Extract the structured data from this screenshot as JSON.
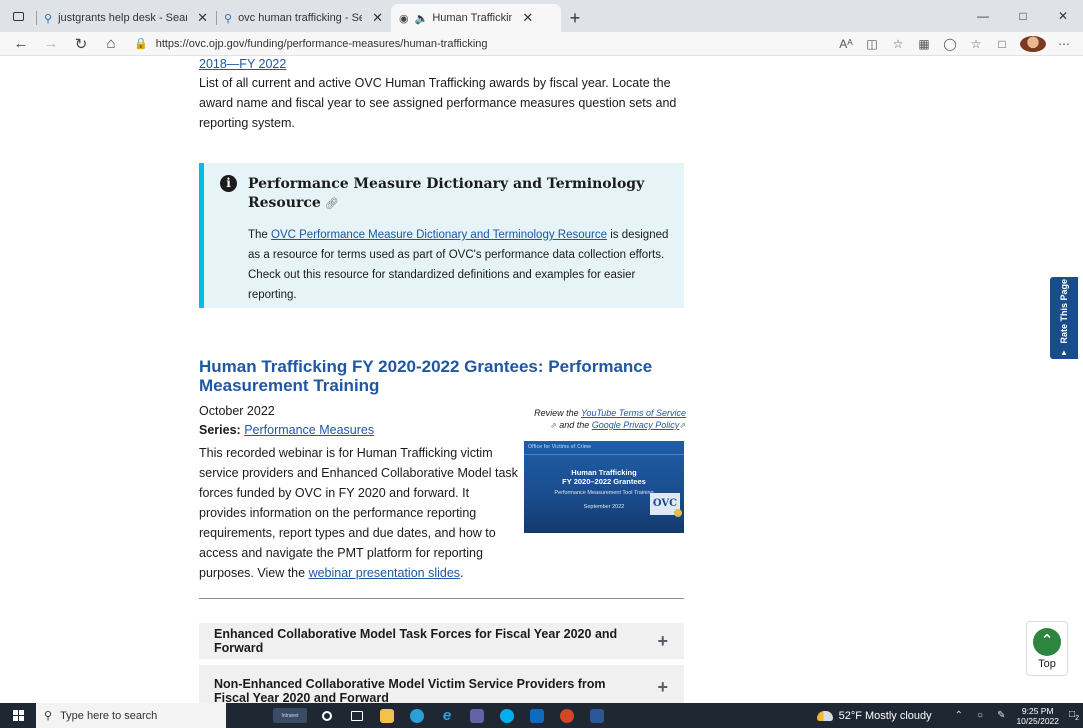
{
  "browser": {
    "tabs": [
      {
        "label": "justgrants help desk - Search",
        "icon": "search-icon"
      },
      {
        "label": "ovc human trafficking - Search",
        "icon": "search-icon"
      },
      {
        "label": "Human Trafficking Grantee",
        "icon": "speaker-icon",
        "active": true
      }
    ],
    "new_tab_glyph": "+",
    "url": "https://ovc.ojp.gov/funding/performance-measures/human-trafficking",
    "reader_glyph": "Aᴬ"
  },
  "page": {
    "top_link": "2018—FY 2022",
    "top_desc": "List of all current and active OVC Human Trafficking awards by fiscal year. Locate the award name and fiscal year to see assigned performance measures question sets and reporting system.",
    "info_box": {
      "title": "Performance Measure Dictionary and Terminology Resource",
      "body_prefix": "The ",
      "body_link": "OVC Performance Measure Dictionary and Terminology Resource",
      "body_suffix": " is designed as a resource for terms used as part of OVC's performance data collection efforts. Check out this resource for standardized definitions and examples for easier reporting."
    },
    "section": {
      "heading": "Human Trafficking FY 2020-2022 Grantees: Performance Measurement Training",
      "date": "October 2022",
      "series_label": "Series:",
      "series_link": "Performance Measures",
      "body_prefix": "This recorded webinar is for Human Trafficking victim service providers and Enhanced Collaborative Model task forces funded by OVC in FY 2020 and forward. It provides information on the performance reporting requirements, report types and due dates, and how to access and navigate the PMT platform for reporting purposes. View the ",
      "body_link": "webinar presentation slides",
      "body_suffix": ".",
      "note_prefix": "Review the ",
      "note_link1": "YouTube Terms of Service",
      "note_mid": " and the ",
      "note_link2": "Google Privacy Policy",
      "thumbnail": {
        "header": "Office for Victims of Crime",
        "line1": "Human Trafficking",
        "line2": "FY 2020–2022 Grantees",
        "line3": "Performance Measurement Tool Training",
        "line4": "September 2022",
        "logo": "OVC"
      }
    },
    "accordions": [
      {
        "label": "Enhanced Collaborative Model Task Forces for Fiscal Year 2020 and Forward"
      },
      {
        "label": "Non-Enhanced Collaborative Model Victim Service Providers from Fiscal Year 2020 and Forward"
      }
    ],
    "rate_this_page": "Rate This Page",
    "top_button": "Top"
  },
  "taskbar": {
    "search_placeholder": "Type here to search",
    "intranet_label": "Intranet",
    "weather": "52°F  Mostly cloudy",
    "time": "9:25 PM",
    "date": "10/25/2022",
    "notification_count": "2"
  },
  "colors": {
    "link": "#1f57a3",
    "info_accent": "#00bde3",
    "info_bg": "#e6f4f8",
    "top_green": "#2e8540",
    "rate_blue": "#1a4c8c"
  }
}
